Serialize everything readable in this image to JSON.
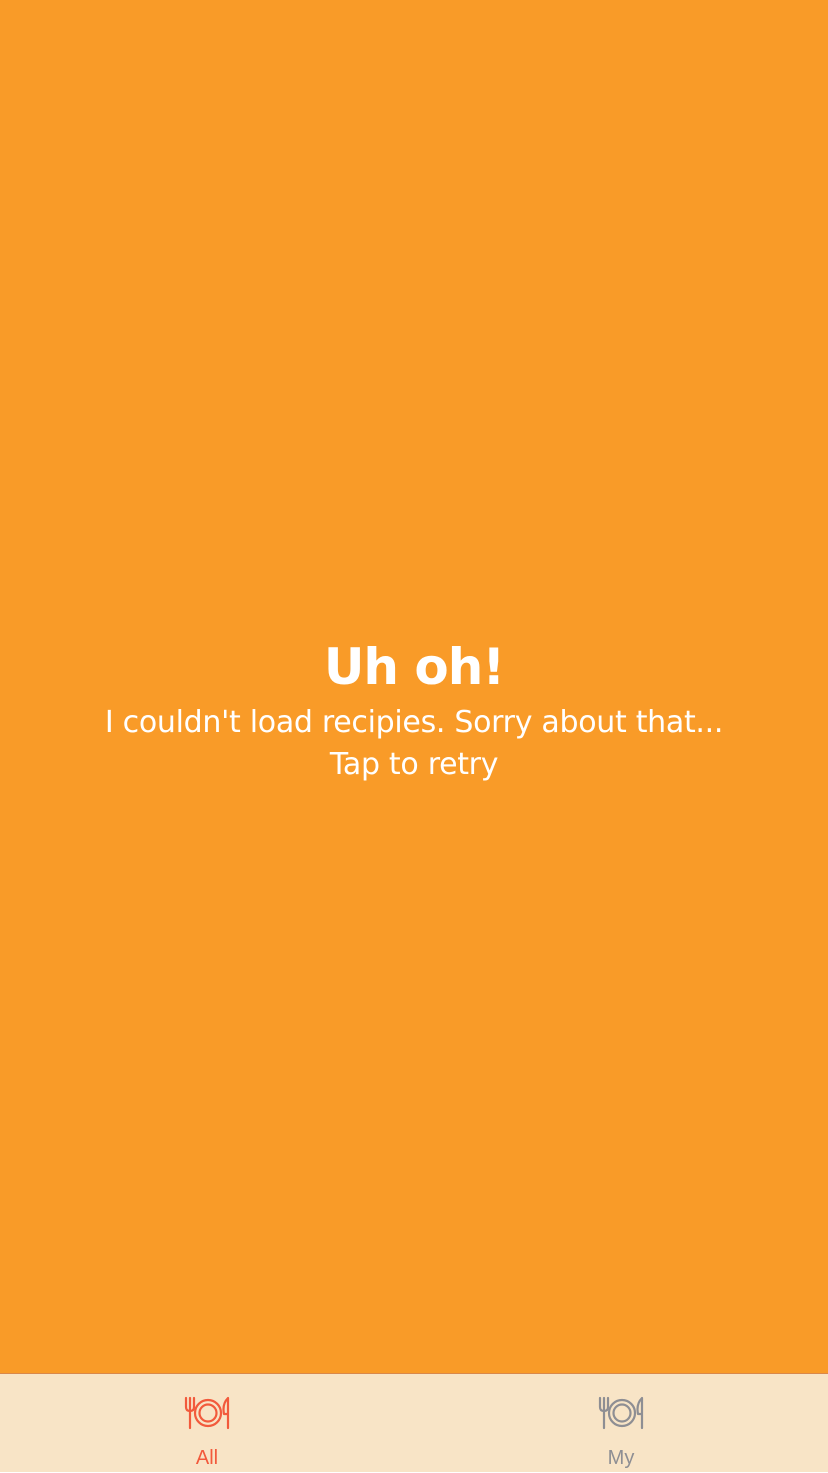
{
  "colors": {
    "background": "#f99b28",
    "tabbar_background": "#f8e4c6",
    "active_tab": "#f25a3c",
    "inactive_tab": "#8e8e93",
    "text": "#ffffff"
  },
  "error": {
    "title": "Uh oh!",
    "message": "I couldn't load recipies. Sorry about that...",
    "retry": "Tap to retry"
  },
  "tabs": [
    {
      "label": "All",
      "icon": "plate-fork-knife-icon",
      "active": true
    },
    {
      "label": "My",
      "icon": "plate-fork-knife-icon",
      "active": false
    }
  ]
}
